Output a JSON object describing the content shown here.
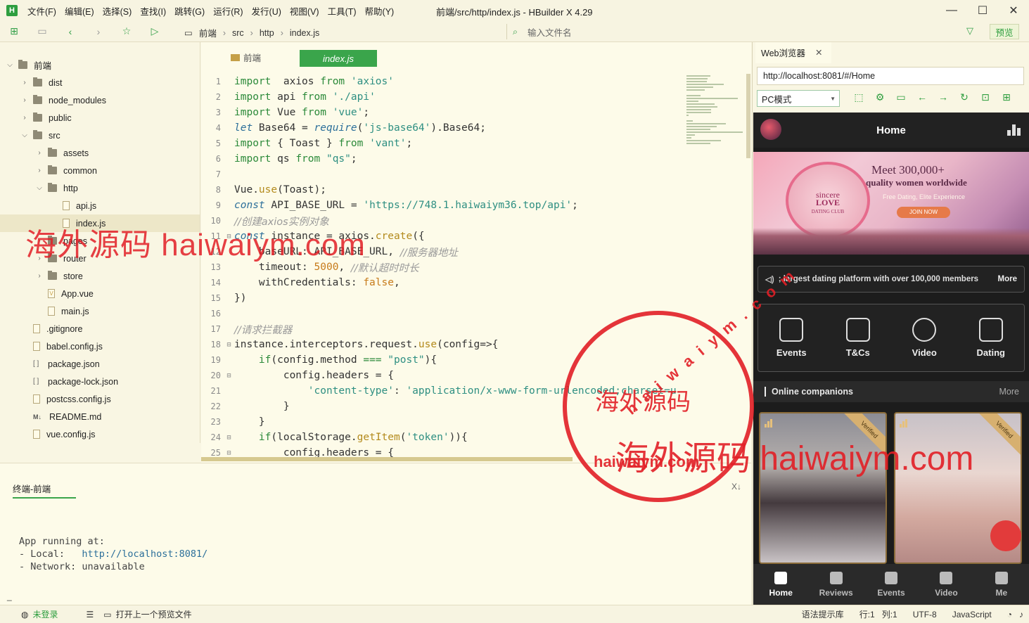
{
  "app": {
    "logo": "H",
    "title": "前端/src/http/index.js - HBuilder X 4.29",
    "menus": [
      "文件(F)",
      "编辑(E)",
      "选择(S)",
      "查找(I)",
      "跳转(G)",
      "运行(R)",
      "发行(U)",
      "视图(V)",
      "工具(T)",
      "帮助(Y)"
    ],
    "win": {
      "min": "—",
      "max": "☐",
      "close": "✕"
    }
  },
  "toolbar": {
    "crumbs": [
      "前端",
      "src",
      "http",
      "index.js"
    ],
    "search_placeholder": "输入文件名",
    "preview": "预览"
  },
  "tree": [
    {
      "label": "前端",
      "type": "folder",
      "open": true,
      "depth": 0
    },
    {
      "label": "dist",
      "type": "folder",
      "depth": 1
    },
    {
      "label": "node_modules",
      "type": "folder",
      "depth": 1
    },
    {
      "label": "public",
      "type": "folder",
      "depth": 1
    },
    {
      "label": "src",
      "type": "folder",
      "open": true,
      "depth": 1
    },
    {
      "label": "assets",
      "type": "folder",
      "depth": 2
    },
    {
      "label": "common",
      "type": "folder",
      "depth": 2
    },
    {
      "label": "http",
      "type": "folder",
      "open": true,
      "depth": 2
    },
    {
      "label": "api.js",
      "type": "file",
      "depth": 3
    },
    {
      "label": "index.js",
      "type": "file",
      "depth": 3,
      "selected": true
    },
    {
      "label": "pages",
      "type": "folder",
      "depth": 2
    },
    {
      "label": "router",
      "type": "folder",
      "depth": 2
    },
    {
      "label": "store",
      "type": "folder",
      "depth": 2
    },
    {
      "label": "App.vue",
      "type": "vue",
      "depth": 2
    },
    {
      "label": "main.js",
      "type": "file",
      "depth": 2
    },
    {
      "label": ".gitignore",
      "type": "file",
      "depth": 1
    },
    {
      "label": "babel.config.js",
      "type": "file",
      "depth": 1
    },
    {
      "label": "package.json",
      "type": "json",
      "depth": 1
    },
    {
      "label": "package-lock.json",
      "type": "json",
      "depth": 1
    },
    {
      "label": "postcss.config.js",
      "type": "file",
      "depth": 1
    },
    {
      "label": "README.md",
      "type": "md",
      "depth": 1
    },
    {
      "label": "vue.config.js",
      "type": "file",
      "depth": 1
    }
  ],
  "editor": {
    "tabs": [
      "前端",
      "index.js"
    ]
  },
  "code": [
    [
      [
        "kw",
        "import"
      ],
      [
        "",
        "  axios "
      ],
      [
        "kw",
        "from"
      ],
      [
        "str",
        " 'axios'"
      ]
    ],
    [
      [
        "kw",
        "import"
      ],
      [
        "",
        " api "
      ],
      [
        "kw",
        "from"
      ],
      [
        "str",
        " './api'"
      ]
    ],
    [
      [
        "kw",
        "import"
      ],
      [
        "",
        " Vue "
      ],
      [
        "kw",
        "from"
      ],
      [
        "str",
        " 'vue'"
      ],
      [
        "",
        ";"
      ]
    ],
    [
      [
        "it",
        "let"
      ],
      [
        "",
        " Base64 = "
      ],
      [
        "it",
        "require"
      ],
      [
        "",
        "("
      ],
      [
        "str",
        "'js-base64'"
      ],
      [
        "",
        ").Base64;"
      ]
    ],
    [
      [
        "kw",
        "import"
      ],
      [
        "",
        " { Toast } "
      ],
      [
        "kw",
        "from"
      ],
      [
        "str",
        " 'vant'"
      ],
      [
        "",
        ";"
      ]
    ],
    [
      [
        "kw",
        "import"
      ],
      [
        "",
        " qs "
      ],
      [
        "kw",
        "from"
      ],
      [
        "str",
        " \"qs\""
      ],
      [
        "",
        ";"
      ]
    ],
    [],
    [
      [
        "",
        "Vue."
      ],
      [
        "fn",
        "use"
      ],
      [
        "",
        "(Toast);"
      ]
    ],
    [
      [
        "it",
        "const"
      ],
      [
        "",
        " API_BASE_URL = "
      ],
      [
        "str",
        "'https://748.1.haiwaiym36.top/api'"
      ],
      [
        "",
        ";"
      ]
    ],
    [
      [
        "cm",
        "//创建axios实例对象"
      ]
    ],
    [
      [
        "it",
        "const"
      ],
      [
        "",
        " instance = axios."
      ],
      [
        "fn",
        "create"
      ],
      [
        "",
        "({"
      ]
    ],
    [
      [
        "",
        "    baseURL: API_BASE_URL, "
      ],
      [
        "cm",
        "//服务器地址"
      ]
    ],
    [
      [
        "",
        "    timeout: "
      ],
      [
        "num",
        "5000"
      ],
      [
        "",
        ", "
      ],
      [
        "cm",
        "//默认超时时长"
      ]
    ],
    [
      [
        "",
        "    withCredentials: "
      ],
      [
        "num",
        "false"
      ],
      [
        "",
        ","
      ]
    ],
    [
      [
        "",
        "})"
      ]
    ],
    [],
    [
      [
        "cm",
        "//请求拦截器"
      ]
    ],
    [
      [
        "",
        "instance.interceptors.request."
      ],
      [
        "fn",
        "use"
      ],
      [
        "",
        "(config=>{"
      ]
    ],
    [
      [
        "",
        "    "
      ],
      [
        "kw",
        "if"
      ],
      [
        "",
        "(config.method "
      ],
      [
        "kw",
        "==="
      ],
      [
        "str",
        " \"post\""
      ],
      [
        "",
        "){"
      ]
    ],
    [
      [
        "",
        "        config.headers = {"
      ]
    ],
    [
      [
        "",
        "            "
      ],
      [
        "str",
        "'content-type'"
      ],
      [
        "",
        ": "
      ],
      [
        "str",
        "'application/x-www-form-urlencoded;charset=u"
      ]
    ],
    [
      [
        "",
        "        }"
      ]
    ],
    [
      [
        "",
        "    }"
      ]
    ],
    [
      [
        "",
        "    "
      ],
      [
        "kw",
        "if"
      ],
      [
        "",
        "(localStorage."
      ],
      [
        "fn",
        "getItem"
      ],
      [
        "",
        "("
      ],
      [
        "str",
        "'token'"
      ],
      [
        "",
        "))"
      ],
      [
        "",
        "{"
      ]
    ],
    [
      [
        "",
        "        config.headers = {"
      ]
    ]
  ],
  "folds": [
    11,
    18,
    20,
    24,
    25
  ],
  "terminal": {
    "tab": "终端-前端",
    "close": "X↓",
    "lines": [
      "App running at:",
      "- Local:   ",
      "- Network: unavailable"
    ],
    "local_url": "http://localhost:8081/",
    "cursor": "_"
  },
  "status": {
    "login": "未登录",
    "hint": "打开上一个预览文件",
    "syntax": "语法提示库",
    "row": "行:1",
    "col": "列:1",
    "enc": "UTF-8",
    "lang": "JavaScript"
  },
  "browser": {
    "tab": "Web浏览器",
    "url": "http://localhost:8081/#/Home",
    "mode": "PC模式"
  },
  "mobile": {
    "title": "Home",
    "banner": {
      "line1": "Meet 300,000+",
      "line2": "quality women worldwide",
      "line3": "Free Dating, Elite Experience",
      "join": "JOIN NOW",
      "logo1": "sincere",
      "logo2": "LOVE",
      "logo3": "DATING CLUB"
    },
    "notice": "; largest dating platform with over 100,000 members",
    "notice_more": "More",
    "grid": [
      "Events",
      "T&Cs",
      "Video",
      "Dating"
    ],
    "section": "Online companions",
    "section_more": "More",
    "badge": "Verified",
    "tabs": [
      "Home",
      "Reviews",
      "Events",
      "Video",
      "Me"
    ]
  },
  "watermark": {
    "text1": "海外源码 haiwaiym.com",
    "stamp_cn": "海外源码",
    "stamp_url": "haiwaiym.com",
    "stamp_ring": "haiwaiym.com",
    "text2": "海外源码 haiwaiym.com"
  }
}
